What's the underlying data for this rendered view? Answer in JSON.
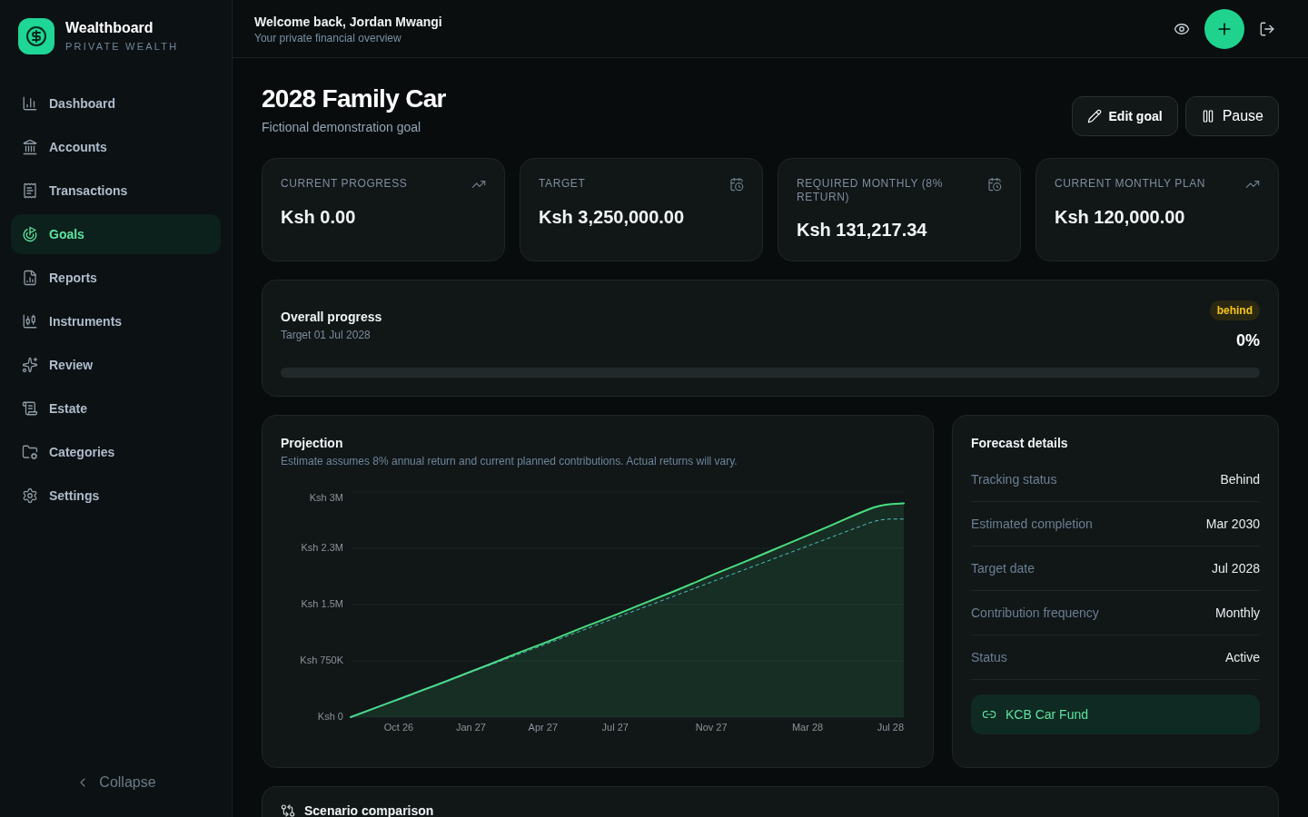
{
  "sidebar": {
    "brand": {
      "name": "Wealthboard",
      "tagline": "PRIVATE WEALTH"
    },
    "items": [
      {
        "label": "Dashboard",
        "selected": false
      },
      {
        "label": "Accounts",
        "selected": false
      },
      {
        "label": "Transactions",
        "selected": false
      },
      {
        "label": "Goals",
        "selected": true
      },
      {
        "label": "Reports",
        "selected": false
      },
      {
        "label": "Instruments",
        "selected": false
      },
      {
        "label": "Review",
        "selected": false
      },
      {
        "label": "Estate",
        "selected": false
      },
      {
        "label": "Categories",
        "selected": false
      },
      {
        "label": "Settings",
        "selected": false
      }
    ],
    "collapse": {
      "label": "Collapse"
    }
  },
  "header": {
    "greeting": "Welcome back, Jordan Mwangi",
    "subtitle": "Your private financial overview"
  },
  "goal": {
    "title": "2028 Family Car",
    "subtitle": "Fictional demonstration goal",
    "actions": [
      {
        "label": "Edit goal"
      },
      {
        "label": "Pause"
      }
    ]
  },
  "stats": [
    {
      "label": "CURRENT PROGRESS",
      "value": "Ksh 0.00"
    },
    {
      "label": "TARGET",
      "value": "Ksh 3,250,000.00"
    },
    {
      "label": "REQUIRED MONTHLY (8% RETURN)",
      "value": "Ksh 131,217.34"
    },
    {
      "label": "CURRENT MONTHLY PLAN",
      "value": "Ksh 120,000.00"
    }
  ],
  "progress": {
    "title": "Overall progress",
    "target": "Target 01 Jul 2028",
    "badge": "behind",
    "percent": "0%",
    "level": 0
  },
  "projection": {
    "title": "Projection",
    "subtitle": "Estimate assumes 8% annual return and current planned contributions. Actual returns will vary.",
    "y_axis_labels": [
      "Ksh 3M",
      "Ksh 2.3M",
      "Ksh 1.5M",
      "Ksh 750K",
      "Ksh 0"
    ],
    "x_axis_labels": [
      "Oct 26",
      "Jan 27",
      "Apr 27",
      "Jul 27",
      "Nov 27",
      "Mar 28",
      "Jul 28"
    ]
  },
  "forecast": {
    "title": "Forecast details",
    "rows": [
      {
        "label": "Tracking status",
        "value": "Behind"
      },
      {
        "label": "Estimated completion",
        "value": "Mar 2030"
      },
      {
        "label": "Target date",
        "value": "Jul 2028"
      },
      {
        "label": "Contribution frequency",
        "value": "Monthly"
      },
      {
        "label": "Status",
        "value": "Active"
      }
    ],
    "link": {
      "label": "KCB Car Fund"
    }
  },
  "scenario_comparison": {
    "title": "Scenario comparison"
  }
}
